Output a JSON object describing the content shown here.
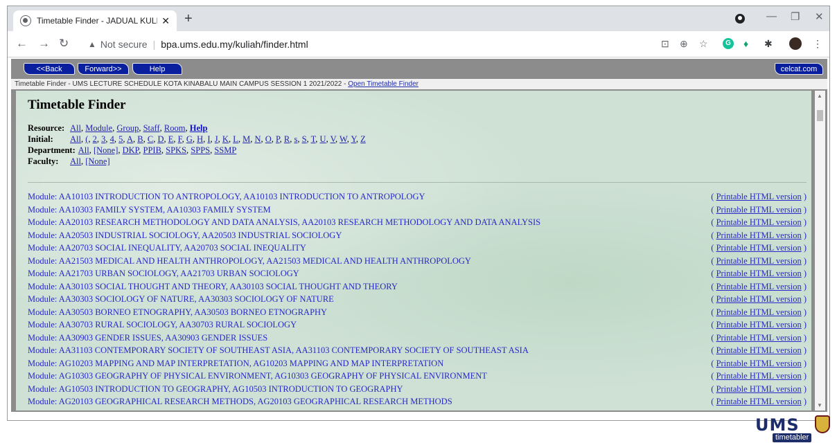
{
  "browser": {
    "tab_title": "Timetable Finder - JADUAL KULIA",
    "tab_close": "✕",
    "new_tab": "+",
    "security_label": "Not secure",
    "url": "bpa.ums.edu.my/kuliah/finder.html",
    "icons": [
      "back-arrow-icon",
      "forward-arrow-icon",
      "reload-icon",
      "warning-icon",
      "translate-icon",
      "zoom-icon",
      "star-icon",
      "grammarly-icon",
      "extension-icon",
      "puzzle-icon",
      "avatar",
      "menu-icon"
    ]
  },
  "celcat": {
    "back_label": "<<Back",
    "forward_label": "Forward>>",
    "help_label": "Help",
    "site_label": "celcat.com",
    "info_text": "Timetable Finder - UMS LECTURE SCHEDULE KOTA KINABALU MAIN CAMPUS SESSION 1 2021/2022 - ",
    "info_link": "Open Timetable Finder",
    "colors": {
      "button": "#0a1f9e",
      "link": "#2828c8",
      "background": "#cfe1d5",
      "frame": "#8c8c8c"
    }
  },
  "finder": {
    "title": "Timetable Finder",
    "resource_label": "Resource:",
    "resource_links": [
      "All",
      "Module",
      "Group",
      "Staff",
      "Room"
    ],
    "resource_help": "Help",
    "initial_label": "Initial:",
    "initial_links": [
      "All",
      "(",
      "2",
      "3",
      "4",
      "5",
      "A",
      "B",
      "C",
      "D",
      "E",
      "F",
      "G",
      "H",
      "I",
      "J",
      "K",
      "L",
      "M",
      "N",
      "O",
      "P",
      "R",
      "s",
      "S",
      "T",
      "U",
      "V",
      "W",
      "Y",
      "Z"
    ],
    "department_label": "Department:",
    "department_links": [
      "All",
      "[None]",
      "DKP",
      "PPIB",
      "SPKS",
      "SPPS",
      "SSMP"
    ],
    "faculty_label": "Faculty:",
    "faculty_links": [
      "All",
      "[None]"
    ]
  },
  "modules": [
    "Module: AA10103 INTRODUCTION TO ANTROPOLOGY, AA10103 INTRODUCTION TO ANTROPOLOGY",
    "Module: AA10303 FAMILY SYSTEM, AA10303 FAMILY SYSTEM",
    "Module: AA20103 RESEARCH METHODOLOGY AND DATA ANALYSIS, AA20103 RESEARCH METHODOLOGY AND DATA ANALYSIS",
    "Module: AA20503 INDUSTRIAL SOCIOLOGY, AA20503 INDUSTRIAL SOCIOLOGY",
    "Module: AA20703 SOCIAL INEQUALITY, AA20703 SOCIAL INEQUALITY",
    "Module: AA21503 MEDICAL AND HEALTH ANTHROPOLOGY, AA21503 MEDICAL AND HEALTH ANTHROPOLOGY",
    "Module: AA21703 URBAN SOCIOLOGY, AA21703 URBAN SOCIOLOGY",
    "Module: AA30103 SOCIAL THOUGHT AND THEORY, AA30103 SOCIAL THOUGHT AND THEORY",
    "Module: AA30303 SOCIOLOGY OF NATURE, AA30303 SOCIOLOGY OF NATURE",
    "Module: AA30503 BORNEO ETNOGRAPHY, AA30503 BORNEO ETNOGRAPHY",
    "Module: AA30703 RURAL SOCIOLOGY, AA30703 RURAL SOCIOLOGY",
    "Module: AA30903 GENDER ISSUES, AA30903 GENDER ISSUES",
    "Module: AA31103 CONTEMPORARY SOCIETY OF SOUTHEAST ASIA, AA31103 CONTEMPORARY SOCIETY OF SOUTHEAST ASIA",
    "Module: AG10203 MAPPING AND MAP INTERPRETATION, AG10203 MAPPING AND MAP INTERPRETATION",
    "Module: AG10303 GEOGRAPHY OF PHYSICAL ENVIRONMENT, AG10303 GEOGRAPHY OF PHYSICAL ENVIRONMENT",
    "Module: AG10503 INTRODUCTION TO GEOGRAPHY, AG10503 INTRODUCTION TO GEOGRAPHY",
    "Module: AG20103 GEOGRAPHICAL RESEARCH METHODS, AG20103 GEOGRAPHICAL RESEARCH METHODS"
  ],
  "printable_label": "Printable HTML version",
  "paren_open": "( ",
  "paren_close": " )",
  "logo": {
    "name": "UMS",
    "tagline": "timetabler"
  }
}
